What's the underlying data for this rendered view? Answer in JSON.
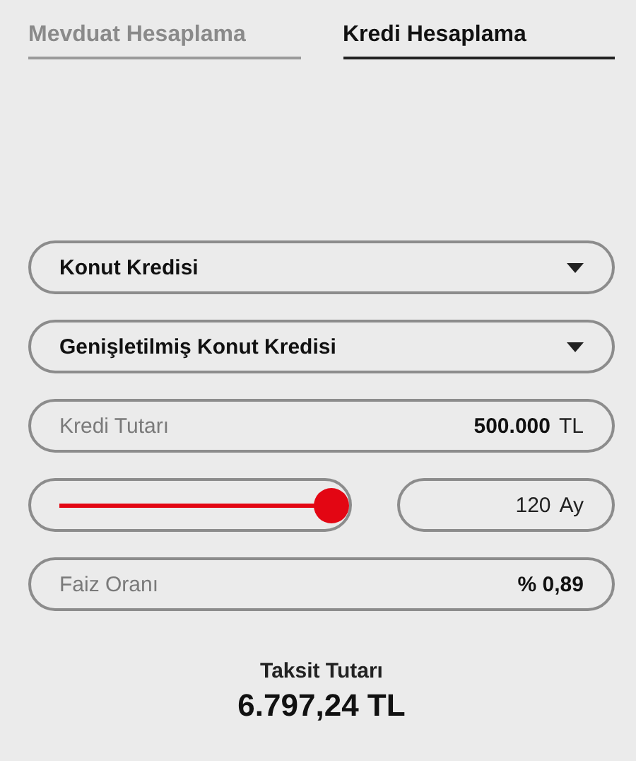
{
  "tabs": [
    {
      "label": "Mevduat Hesaplama",
      "selected": false
    },
    {
      "label": "Kredi Hesaplama",
      "selected": true
    }
  ],
  "credit_type": {
    "value": "Konut Kredisi"
  },
  "credit_subtype": {
    "value": "Genişletilmiş Konut Kredisi"
  },
  "loan_amount": {
    "label": "Kredi Tutarı",
    "value": "500.000",
    "unit": "TL"
  },
  "term": {
    "level": 1,
    "value": "120",
    "unit": "Ay"
  },
  "interest_rate": {
    "label": "Faiz Oranı",
    "value": "% 0,89"
  },
  "result": {
    "label": "Taksit Tutarı",
    "value": "6.797,24 TL"
  }
}
